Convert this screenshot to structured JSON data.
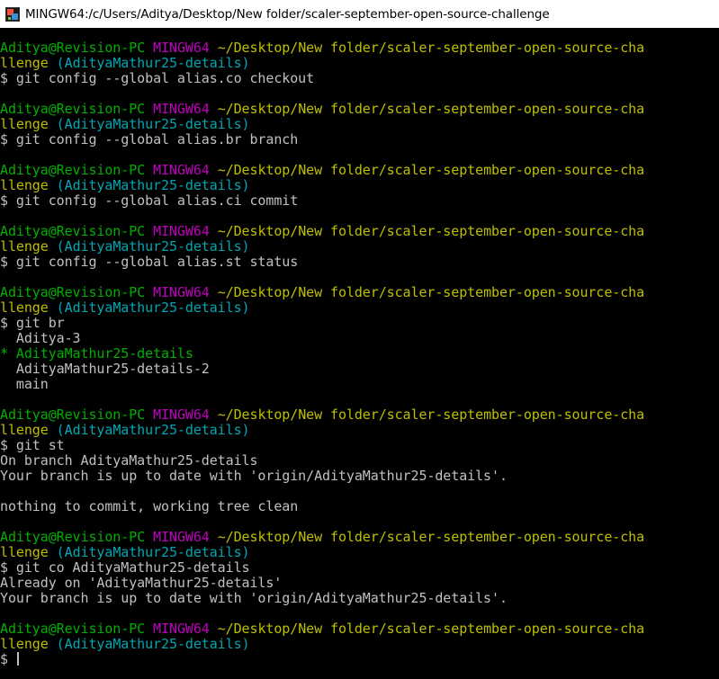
{
  "window": {
    "title": "MINGW64:/c/Users/Aditya/Desktop/New folder/scaler-september-open-source-challenge"
  },
  "colors": {
    "background": "#000000",
    "user_host": "#00b000",
    "mingw": "#bf00bf",
    "path": "#bfbf00",
    "branch": "#00a6b2",
    "text": "#c0c0c0",
    "current_branch": "#00b000"
  },
  "prompt": {
    "user_host": "Aditya@Revision-PC",
    "env": "MINGW64",
    "path_line1": "~/Desktop/New folder/scaler-september-open-source-cha",
    "path_line2": "llenge",
    "branch": "(AdityaMathur25-details)",
    "symbol": "$"
  },
  "sessions": [
    {
      "command": "git config --global alias.co checkout",
      "output": []
    },
    {
      "command": "git config --global alias.br branch",
      "output": []
    },
    {
      "command": "git config --global alias.ci commit",
      "output": []
    },
    {
      "command": "git config --global alias.st status",
      "output": []
    },
    {
      "command": "git br",
      "output": [
        {
          "text": "  Aditya-3",
          "current": false
        },
        {
          "text": "* AdityaMathur25-details",
          "current": true
        },
        {
          "text": "  AdityaMathur25-details-2",
          "current": false
        },
        {
          "text": "  main",
          "current": false
        }
      ]
    },
    {
      "command": "git st",
      "output": [
        {
          "text": "On branch AdityaMathur25-details",
          "current": false
        },
        {
          "text": "Your branch is up to date with 'origin/AdityaMathur25-details'.",
          "current": false
        },
        {
          "text": "",
          "current": false
        },
        {
          "text": "nothing to commit, working tree clean",
          "current": false
        }
      ]
    },
    {
      "command": "git co AdityaMathur25-details",
      "output": [
        {
          "text": "Already on 'AdityaMathur25-details'",
          "current": false
        },
        {
          "text": "Your branch is up to date with 'origin/AdityaMathur25-details'.",
          "current": false
        }
      ]
    }
  ],
  "final_prompt": {
    "command": ""
  }
}
